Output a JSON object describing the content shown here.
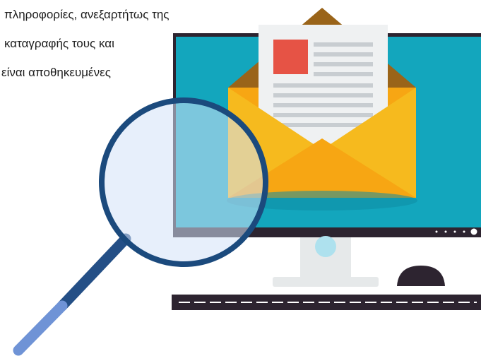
{
  "caption": {
    "line1": "πληροφορίες, ανεξαρτήτως της",
    "line2": "καταγραφής τους και",
    "line3": "είναι αποθηκευμένες"
  },
  "colors": {
    "screen": "#13a6bd",
    "monitor_frame": "#2d2430",
    "envelope_front": "#f6ba1e",
    "envelope_inner": "#f7a613",
    "envelope_flap": "#9a6419",
    "letter": "#eff1f2",
    "letter_lines": "#c8cdd1",
    "letter_image": "#e65345",
    "stand": "#e6e9ea",
    "power_indicator": "#aee1ee",
    "magnifier_ring": "#1b4a7d",
    "magnifier_lens": "#d4e2f7",
    "handle_dark": "#244f86",
    "handle_light": "#6f93d6",
    "keyboard": "#2d2430",
    "mouse": "#2d2430"
  },
  "icons": {
    "monitor": "desktop-monitor-icon",
    "envelope": "open-envelope-icon",
    "letter": "document-letter-icon",
    "magnifier": "magnifying-glass-icon",
    "keyboard": "keyboard-icon",
    "mouse": "computer-mouse-icon"
  }
}
